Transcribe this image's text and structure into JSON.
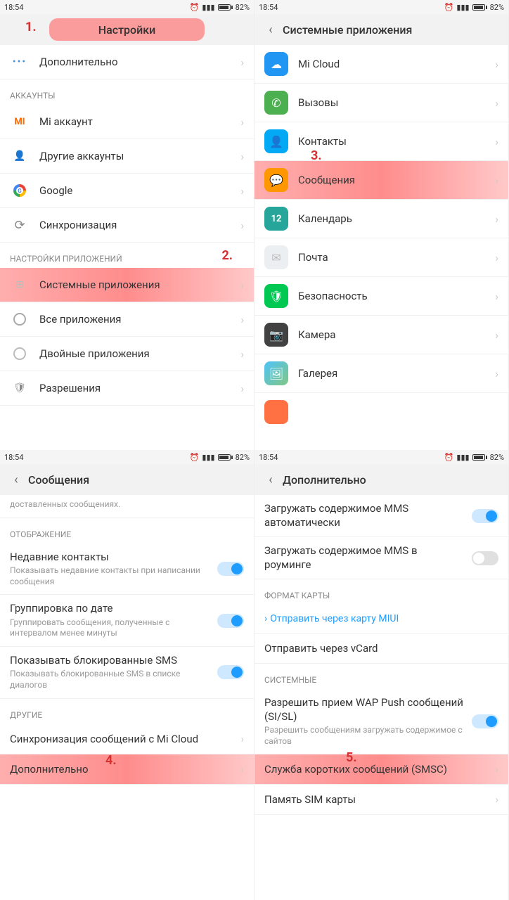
{
  "status": {
    "time": "18:54",
    "battery": "82%"
  },
  "annotations": {
    "a1": "1.",
    "a2": "2.",
    "a3": "3.",
    "a4": "4.",
    "a5": "5."
  },
  "panel1": {
    "title": "Настройки",
    "items": {
      "more": "Дополнительно",
      "sec_accounts": "АККАУНТЫ",
      "mi_account": "Mi аккаунт",
      "other_accounts": "Другие аккаунты",
      "google": "Google",
      "sync": "Синхронизация",
      "sec_apps": "НАСТРОЙКИ ПРИЛОЖЕНИЙ",
      "system_apps": "Системные приложения",
      "all_apps": "Все приложения",
      "dual_apps": "Двойные приложения",
      "permissions": "Разрешения"
    }
  },
  "panel2": {
    "title": "Системные приложения",
    "apps": {
      "micloud": "Mi Cloud",
      "calls": "Вызовы",
      "contacts": "Контакты",
      "messages": "Сообщения",
      "calendar": "Календарь",
      "cal_day": "12",
      "mail": "Почта",
      "security": "Безопасность",
      "camera": "Камера",
      "gallery": "Галерея"
    }
  },
  "panel3": {
    "title": "Сообщения",
    "partial_sub": "доставленных сообщениях.",
    "sec_display": "ОТОБРАЖЕНИЕ",
    "recent_title": "Недавние контакты",
    "recent_sub": "Показывать недавние контакты при написании сообщения",
    "group_title": "Группировка по дате",
    "group_sub": "Группировать сообщения, полученные с интервалом менее минуты",
    "blocked_title": "Показывать блокированные SMS",
    "blocked_sub": "Показывать блокированные SMS в списке диалогов",
    "sec_other": "ДРУГИЕ",
    "sync_cloud": "Синхронизация сообщений с Mi Cloud",
    "more": "Дополнительно"
  },
  "panel4": {
    "title": "Дополнительно",
    "mms_auto": "Загружать содержимое MMS автоматически",
    "mms_roam": "Загружать содержимое MMS в роуминге",
    "sec_card": "ФОРМАТ КАРТЫ",
    "send_miui": "Отправить через карту MIUI",
    "send_vcard": "Отправить через vCard",
    "sec_system": "СИСТЕМНЫЕ",
    "wap_title": "Разрешить прием WAP Push сообщений (SI/SL)",
    "wap_sub": "Разрешить сообщениям загружать содержимое с сайтов",
    "smsc": "Служба коротких сообщений (SMSC)",
    "sim": "Память SIM карты"
  }
}
